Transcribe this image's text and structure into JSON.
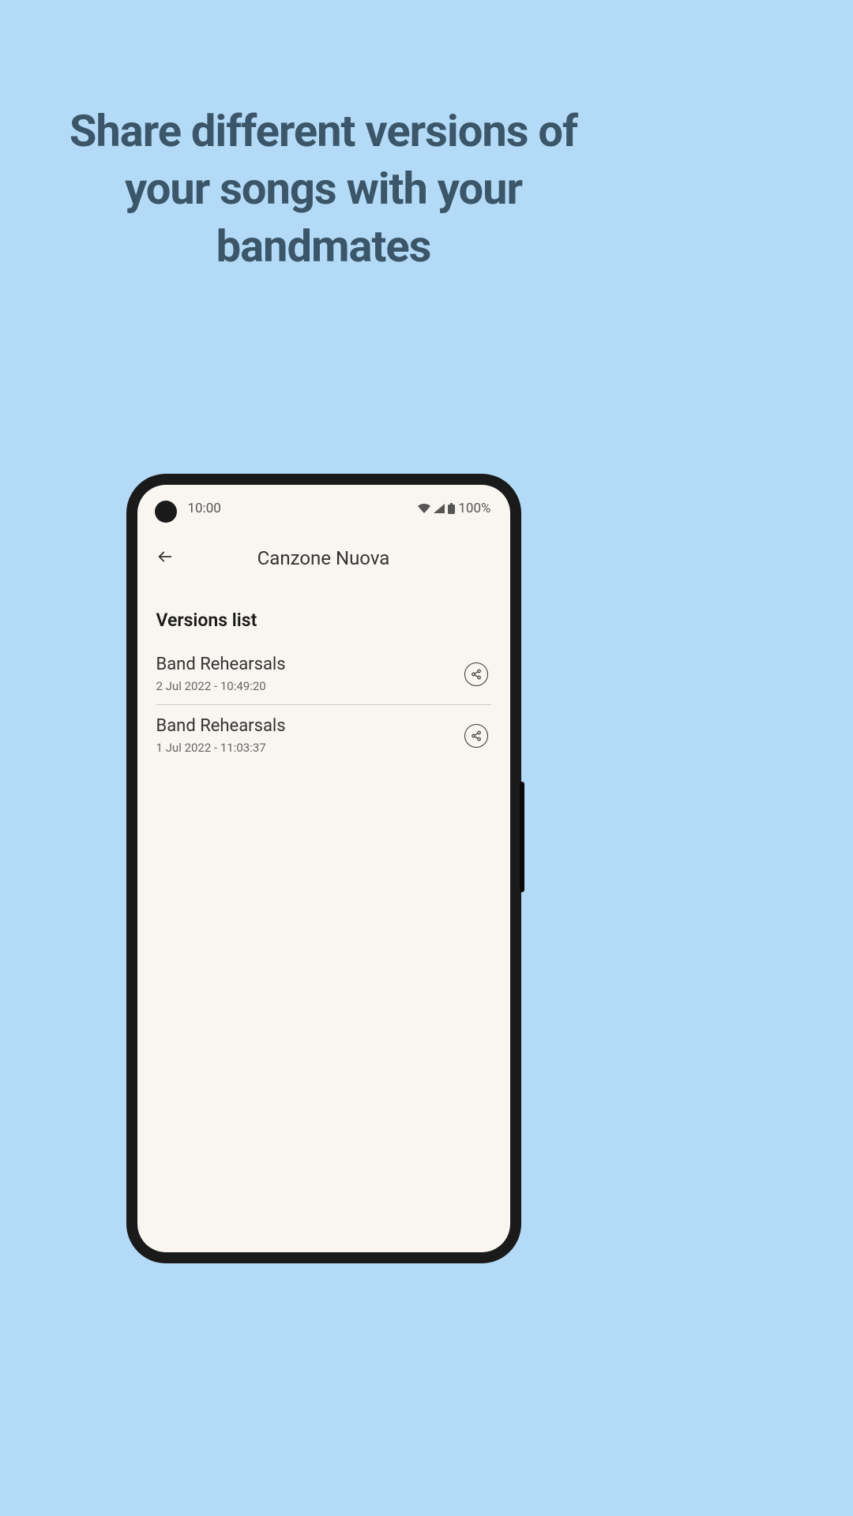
{
  "headline": "Share different versions of your songs with your bandmates",
  "statusBar": {
    "time": "10:00",
    "battery": "100%"
  },
  "app": {
    "title": "Canzone Nuova",
    "sectionTitle": "Versions list",
    "versions": [
      {
        "name": "Band Rehearsals",
        "date": "2 Jul 2022 - 10:49:20"
      },
      {
        "name": "Band Rehearsals",
        "date": "1 Jul 2022 - 11:03:37"
      }
    ]
  }
}
